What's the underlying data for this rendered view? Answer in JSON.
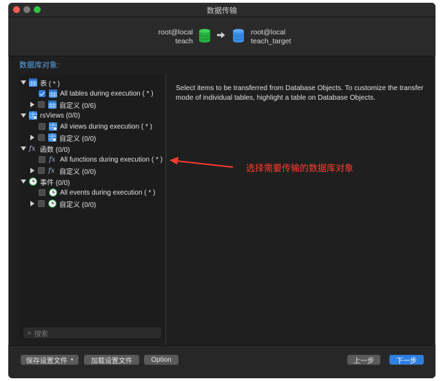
{
  "window": {
    "title": "数据传输"
  },
  "source": {
    "host": "root@local",
    "db": "teach"
  },
  "target": {
    "host": "root@local",
    "db": "teach_target"
  },
  "colors": {
    "source_db": "#27b03f",
    "target_db": "#3b8ee8",
    "accent": "#2e7fe0",
    "annotation": "#ff3b2f"
  },
  "section_label": "数据库对象:",
  "tree": {
    "tables": {
      "label": "表 ( * )",
      "all": "All tables during execution ( * )",
      "custom": "自定义 (0/6)"
    },
    "views": {
      "label": "rsViews (0/0)",
      "all": "All views during execution ( * )",
      "custom": "自定义 (0/0)"
    },
    "functions": {
      "label": "函数 (0/0)",
      "all": "All functions during execution ( * )",
      "custom": "自定义 (0/0)"
    },
    "events": {
      "label": "事件 (0/0)",
      "all": "All events during execution ( * )",
      "custom": "自定义 (0/0)"
    }
  },
  "instructions": "Select items to be transferred from Database Objects. To customize the transfer mode of individual tables, highlight a table on Database Objects.",
  "search": {
    "placeholder": "搜索"
  },
  "footer": {
    "save_settings": "保存设置文件",
    "load_settings": "加载设置文件",
    "option": "Option",
    "previous": "上一步",
    "next": "下一步"
  },
  "annotation": "选择需要传输的数据库对象"
}
